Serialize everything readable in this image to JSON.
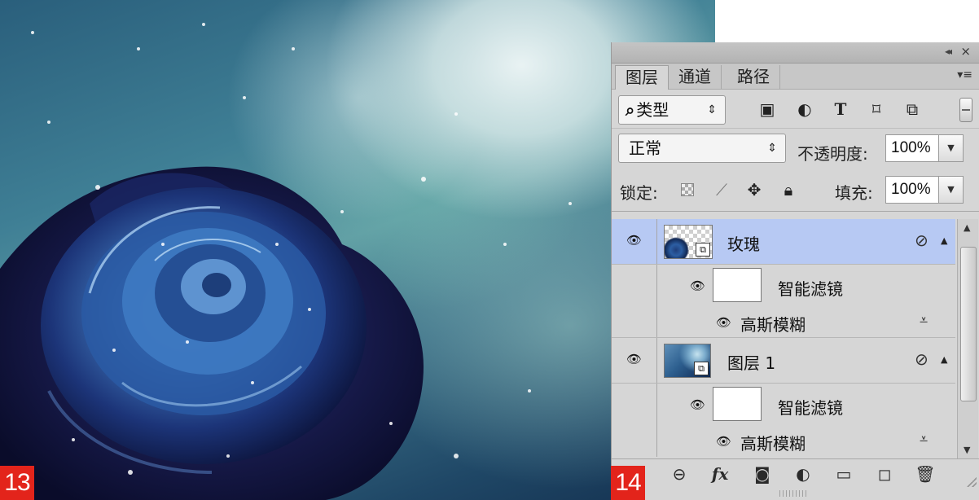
{
  "step_labels": {
    "left": "13",
    "right": "14"
  },
  "panel": {
    "tabs": [
      {
        "label": "图层",
        "active": true
      },
      {
        "label": "通道",
        "active": false
      },
      {
        "label": "路径",
        "active": false
      }
    ],
    "filter": {
      "kind_label": "类型",
      "icons": [
        "image-filter-icon",
        "adjustment-filter-icon",
        "type-filter-icon",
        "shape-filter-icon",
        "smart-object-filter-icon"
      ]
    },
    "blend_mode": "正常",
    "opacity_label": "不透明度:",
    "opacity_value": "100%",
    "lock_label": "锁定:",
    "fill_label": "填充:",
    "fill_value": "100%",
    "layers": [
      {
        "name": "玫瑰",
        "selected": true,
        "smart_filter_label": "智能滤镜",
        "filter_name": "高斯模糊"
      },
      {
        "name": "图层 1",
        "selected": false,
        "smart_filter_label": "智能滤镜",
        "filter_name": "高斯模糊"
      }
    ],
    "bottom_icons": [
      "link-icon",
      "fx-icon",
      "mask-icon",
      "adjustment-layer-icon",
      "group-icon",
      "new-layer-icon",
      "trash-icon"
    ]
  },
  "colors": {
    "badge": "#e3241b",
    "selected_layer": "#b7c9f3",
    "panel_bg": "#d6d6d6"
  }
}
